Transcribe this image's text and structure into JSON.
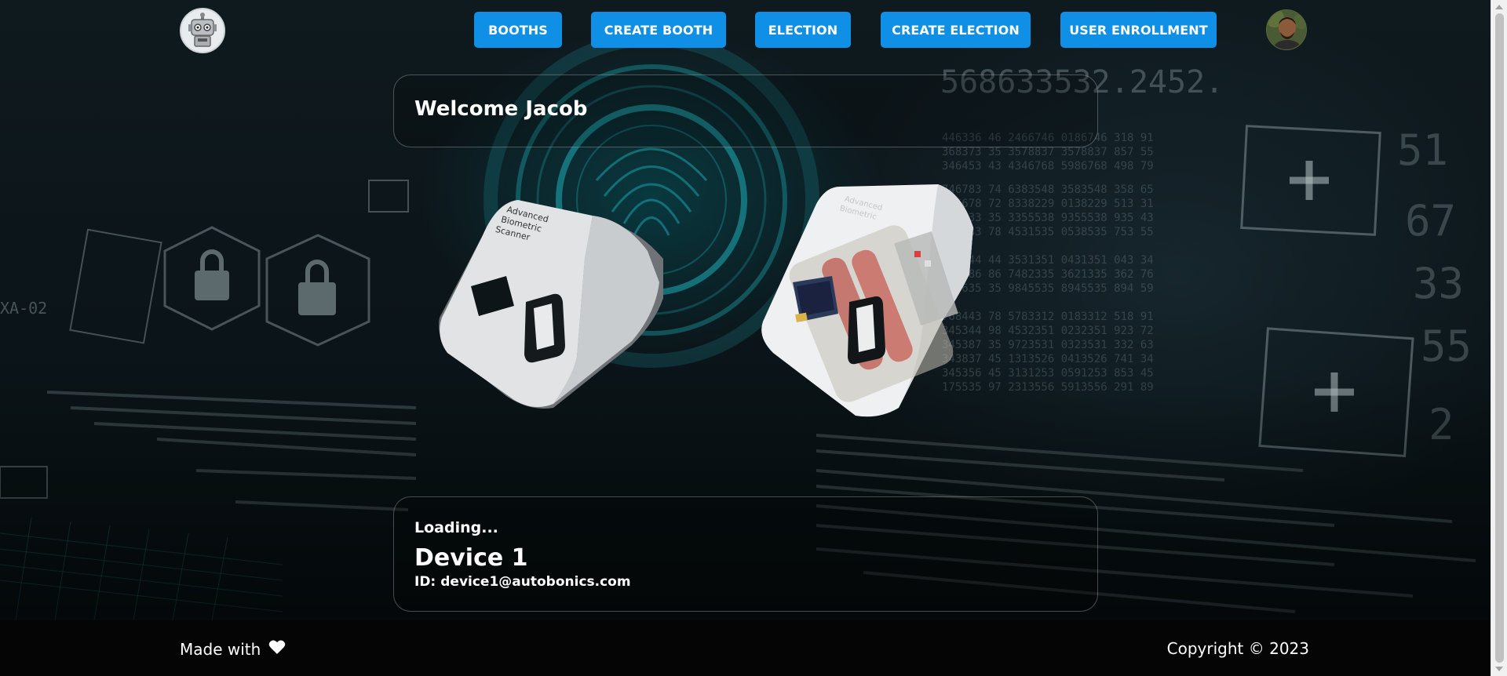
{
  "header": {
    "nav": [
      {
        "label": "BOOTHS"
      },
      {
        "label": "CREATE BOOTH"
      },
      {
        "label": "ELECTION"
      },
      {
        "label": "CREATE ELECTION"
      },
      {
        "label": "USER ENROLLMENT"
      }
    ],
    "logo_icon": "robot-icon",
    "avatar_icon": "user-avatar"
  },
  "welcome": {
    "text": "Welcome Jacob"
  },
  "devices": {
    "scanner_label_lines": [
      "Advanced",
      "Biometric",
      "Scanner"
    ]
  },
  "device_panel": {
    "status": "Loading...",
    "name": "Device 1",
    "id_label": "ID:",
    "id_value": "device1@autobonics.com"
  },
  "footer": {
    "made_with": "Made with",
    "heart_icon": "heart-icon",
    "copyright": "Copyright © 2023"
  },
  "colors": {
    "nav_button": "#0f8fe6",
    "background": "#0b1418",
    "accent_teal": "#1fb9c4"
  }
}
